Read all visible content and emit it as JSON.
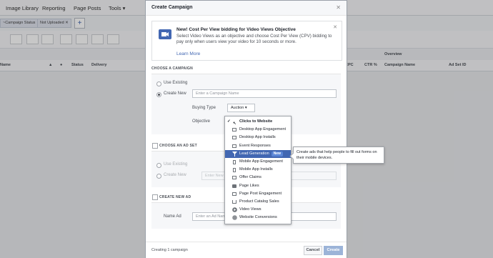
{
  "topnav": {
    "items": [
      "Image Library",
      "Reporting",
      "Page Posts",
      "Tools ▾"
    ]
  },
  "filters": {
    "chip1": "~Campaign Status",
    "chip2": "Not Uploaded",
    "chip2_close": "✕",
    "add": "+"
  },
  "table": {
    "overview_label": "Overview",
    "cols_left": [
      "Name",
      "▲",
      "●",
      "Status",
      "Delivery"
    ],
    "cols_right": [
      "CPC",
      "CTR %",
      "Campaign Name",
      "Ad Set ID"
    ]
  },
  "modal": {
    "title": "Create Campaign",
    "close": "✕",
    "promo": {
      "title": "New! Cost Per View bidding for Video Views Objective",
      "body": "Select Video Views as an objective and choose Cost Per View (CPV) bidding to pay only when users view your video for 10 seconds or more.",
      "link": "Learn More",
      "close": "✕"
    },
    "choose_campaign": {
      "header": "CHOOSE A CAMPAIGN",
      "use_existing": "Use Existing",
      "create_new": "Create New",
      "name_placeholder": "Enter a Campaign Name",
      "buying_type_label": "Buying Type",
      "buying_type_value": "Auction ▾",
      "objective_label": "Objective"
    },
    "choose_adset": {
      "header": "CHOOSE AN AD SET",
      "use_existing": "Use Existing",
      "create_new": "Create New",
      "name_placeholder": "Enter New Ad Set"
    },
    "create_ad": {
      "header": "CREATE NEW AD",
      "name_label": "Name Ad",
      "name_placeholder": "Enter an Ad Name"
    },
    "footer": {
      "status": "Creating 1 campaign",
      "cancel": "Cancel",
      "create": "Create"
    }
  },
  "objective_menu": {
    "items": [
      {
        "label": "Clicks to Website",
        "icon": "cursor-icon",
        "checked": "✓"
      },
      {
        "label": "Desktop App Engagement",
        "icon": "desktop-icon"
      },
      {
        "label": "Desktop App Installs",
        "icon": "desktop-install-icon"
      },
      {
        "label": "Event Responses",
        "icon": "calendar-icon"
      },
      {
        "label": "Lead Generation",
        "icon": "filter-icon",
        "badge": "New"
      },
      {
        "label": "Mobile App Engagement",
        "icon": "mobile-icon"
      },
      {
        "label": "Mobile App Installs",
        "icon": "mobile-install-icon"
      },
      {
        "label": "Offer Claims",
        "icon": "offer-icon"
      },
      {
        "label": "Page Likes",
        "icon": "thumbs-up-icon"
      },
      {
        "label": "Page Post Engagement",
        "icon": "post-icon"
      },
      {
        "label": "Product Catalog Sales",
        "icon": "cart-icon"
      },
      {
        "label": "Video Views",
        "icon": "play-icon"
      },
      {
        "label": "Website Conversions",
        "icon": "globe-icon"
      }
    ],
    "tooltip": "Create ads that help people to fill out forms on their mobile devices."
  }
}
